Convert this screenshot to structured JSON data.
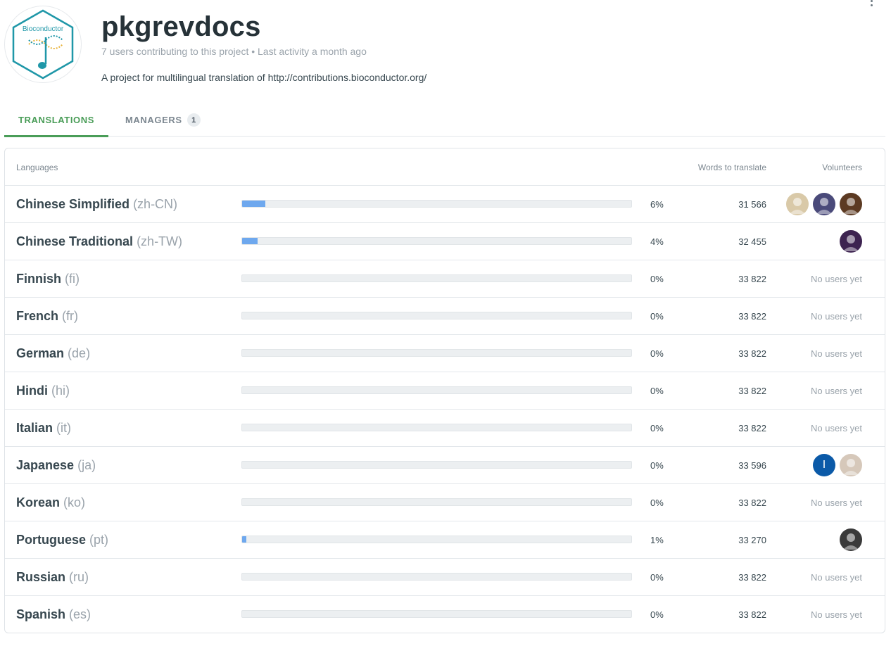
{
  "project": {
    "title": "pkgrevdocs",
    "meta": "7 users contributing to this project • Last activity a month ago",
    "description": "A project for multilingual translation of http://contributions.bioconductor.org/",
    "logo_text": "Bioconductor"
  },
  "tabs": {
    "translations": "TRANSLATIONS",
    "managers": "MANAGERS",
    "managers_count": "1"
  },
  "table": {
    "headers": {
      "languages": "Languages",
      "words": "Words to translate",
      "volunteers": "Volunteers"
    },
    "rows": [
      {
        "name": "Chinese Simplified",
        "code": "(zh-CN)",
        "progress": 0.06,
        "percent": "6%",
        "words": "31 566",
        "volunteers": [
          {
            "color": "#d9c9a8",
            "icon": "user-photo"
          },
          {
            "color": "#4a4a7a",
            "icon": "user-photo"
          },
          {
            "color": "#5c3a22",
            "icon": "user-photo"
          }
        ],
        "no_users": ""
      },
      {
        "name": "Chinese Traditional",
        "code": "(zh-TW)",
        "progress": 0.04,
        "percent": "4%",
        "words": "32 455",
        "volunteers": [
          {
            "color": "#3d2350",
            "icon": "user-photo"
          }
        ],
        "no_users": ""
      },
      {
        "name": "Finnish",
        "code": "(fi)",
        "progress": 0,
        "percent": "0%",
        "words": "33 822",
        "volunteers": [],
        "no_users": "No users yet"
      },
      {
        "name": "French",
        "code": "(fr)",
        "progress": 0,
        "percent": "0%",
        "words": "33 822",
        "volunteers": [],
        "no_users": "No users yet"
      },
      {
        "name": "German",
        "code": "(de)",
        "progress": 0,
        "percent": "0%",
        "words": "33 822",
        "volunteers": [],
        "no_users": "No users yet"
      },
      {
        "name": "Hindi",
        "code": "(hi)",
        "progress": 0,
        "percent": "0%",
        "words": "33 822",
        "volunteers": [],
        "no_users": "No users yet"
      },
      {
        "name": "Italian",
        "code": "(it)",
        "progress": 0,
        "percent": "0%",
        "words": "33 822",
        "volunteers": [],
        "no_users": "No users yet"
      },
      {
        "name": "Japanese",
        "code": "(ja)",
        "progress": 0,
        "percent": "0%",
        "words": "33 596",
        "volunteers": [
          {
            "color": "#0b5aa8",
            "icon": "user-initial",
            "initial": "I"
          },
          {
            "color": "#d6c8ba",
            "icon": "user-photo"
          }
        ],
        "no_users": ""
      },
      {
        "name": "Korean",
        "code": "(ko)",
        "progress": 0,
        "percent": "0%",
        "words": "33 822",
        "volunteers": [],
        "no_users": "No users yet"
      },
      {
        "name": "Portuguese",
        "code": "(pt)",
        "progress": 0.01,
        "percent": "1%",
        "words": "33 270",
        "volunteers": [
          {
            "color": "#3a3a3a",
            "icon": "user-photo"
          }
        ],
        "no_users": ""
      },
      {
        "name": "Russian",
        "code": "(ru)",
        "progress": 0,
        "percent": "0%",
        "words": "33 822",
        "volunteers": [],
        "no_users": "No users yet"
      },
      {
        "name": "Spanish",
        "code": "(es)",
        "progress": 0,
        "percent": "0%",
        "words": "33 822",
        "volunteers": [],
        "no_users": "No users yet"
      }
    ]
  },
  "colors": {
    "accent": "#4a9d58",
    "progress": "#6ea8ee"
  }
}
